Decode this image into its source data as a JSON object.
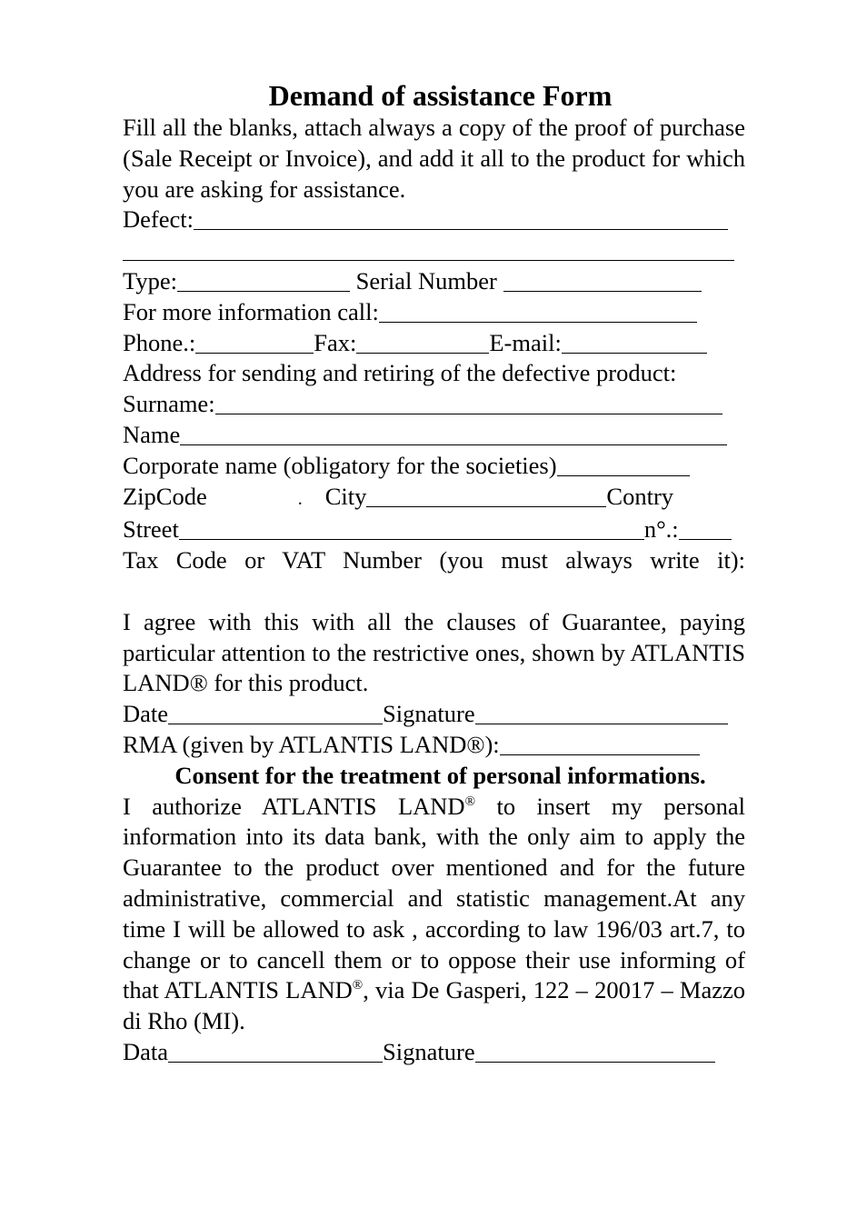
{
  "form": {
    "title": "Demand of assistance Form",
    "intro": "Fill all the blanks, attach always a copy of the proof of purchase (Sale Receipt or Invoice), and add it all to the product for which you are asking for assistance.",
    "fields": {
      "defect": "Defect:",
      "type": "Type:",
      "serial_number": "Serial Number",
      "more_info": "For more information call:",
      "phone": "Phone.:",
      "fax": "Fax:",
      "email": "E-mail:",
      "address_heading": "Address for sending and retiring of the defective product:",
      "surname": "Surname:",
      "name": "Name",
      "corporate_name": "Corporate name (obligatory for the societies)",
      "zipcode": "ZipCode",
      "zipcode_dot": ".",
      "city": "City",
      "country": "Contry",
      "street": "Street",
      "number": "n°.:",
      "tax_code": "Tax Code or VAT Number (you must always write it):"
    },
    "agreement": "I agree with this with all the clauses of Guarantee, paying particular attention to the restrictive ones, shown by ATLANTIS LAND® for this product.",
    "date": "Date",
    "signature": "Signature",
    "rma": "RMA (given by ATLANTIS LAND®):",
    "consent_heading": "Consent for the treatment of personal informations.",
    "consent_part1": "I authorize ATLANTIS LAND",
    "consent_reg": "®",
    "consent_part2": " to insert my personal information into its data bank, with the only aim to apply the Guarantee to the product over mentioned and for the future administrative, commercial and statistic management.At any time I will be allowed to ask , according to law 196/03 art.7, to change or to cancell them or to oppose their use informing of that ATLANTIS LAND",
    "consent_reg2": "®",
    "consent_part3": ", via De Gasperi, 122 – 20017 – Mazzo di Rho (MI).",
    "data": "Data",
    "signature2": "Signature"
  }
}
